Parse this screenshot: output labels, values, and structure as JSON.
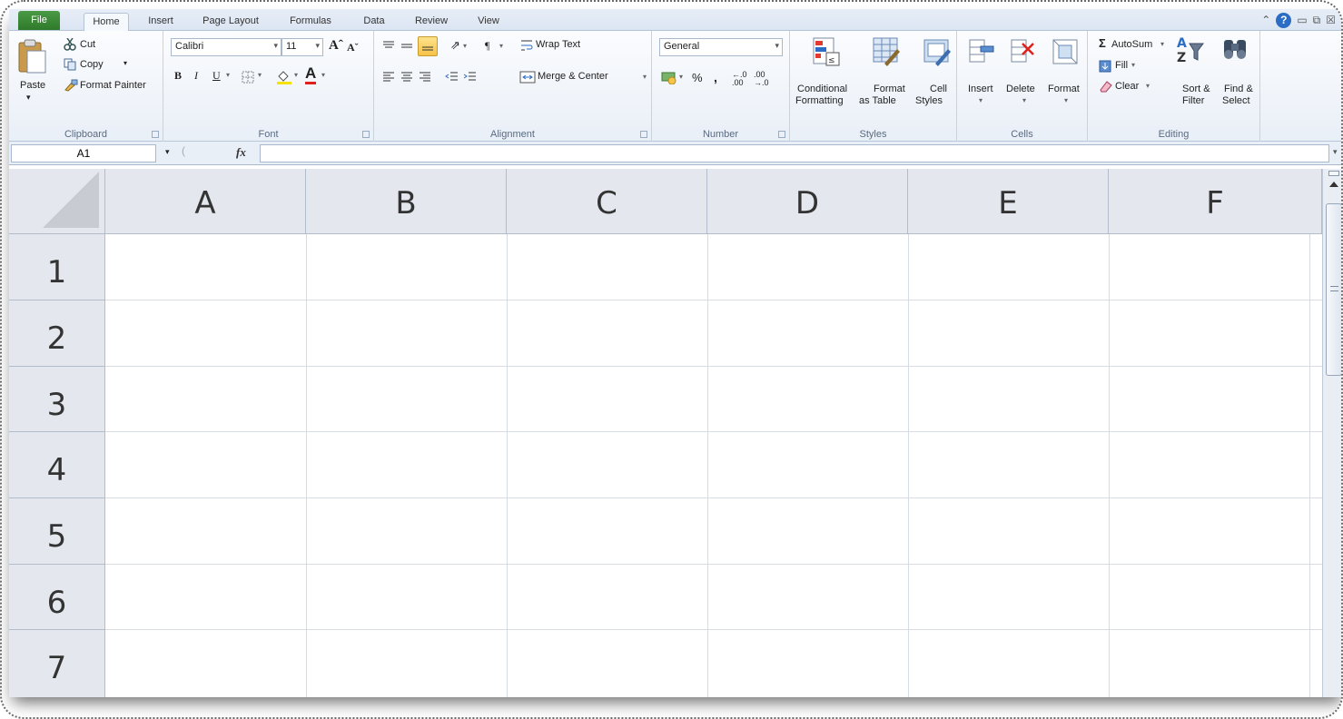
{
  "tabs": [
    {
      "label": "File"
    },
    {
      "label": "Home"
    },
    {
      "label": "Insert"
    },
    {
      "label": "Page Layout"
    },
    {
      "label": "Formulas"
    },
    {
      "label": "Data"
    },
    {
      "label": "Review"
    },
    {
      "label": "View"
    }
  ],
  "active_tab": "Home",
  "clipboard": {
    "paste": "Paste",
    "cut": "Cut",
    "copy": "Copy",
    "format_painter": "Format Painter",
    "group": "Clipboard"
  },
  "font": {
    "name": "Calibri",
    "size": "11",
    "bold": "B",
    "italic": "I",
    "underline": "U",
    "group": "Font"
  },
  "alignment": {
    "wrap_text": "Wrap Text",
    "merge_center": "Merge & Center",
    "group": "Alignment"
  },
  "number": {
    "format": "General",
    "percent": "%",
    "comma": ",",
    "group": "Number"
  },
  "styles": {
    "conditional_1": "Conditional",
    "conditional_2": "Formatting",
    "format_table_1": "Format",
    "format_table_2": "as Table",
    "cell_styles_1": "Cell",
    "cell_styles_2": "Styles",
    "group": "Styles"
  },
  "cells": {
    "insert": "Insert",
    "delete": "Delete",
    "format": "Format",
    "group": "Cells"
  },
  "editing": {
    "autosum": "AutoSum",
    "fill": "Fill",
    "clear": "Clear",
    "sort_1": "Sort &",
    "sort_2": "Filter",
    "find_1": "Find &",
    "find_2": "Select",
    "group": "Editing"
  },
  "formula_bar": {
    "name_box": "A1",
    "fx": "fx",
    "value": ""
  },
  "columns": [
    "A",
    "B",
    "C",
    "D",
    "E",
    "F"
  ],
  "rows": [
    "1",
    "2",
    "3",
    "4",
    "5",
    "6",
    "7"
  ],
  "colors": {
    "file_tab": "#2e7a2b",
    "header_bg": "#e4e8ee",
    "gridline": "#d7dce3",
    "help_icon": "#2b6cc4"
  }
}
